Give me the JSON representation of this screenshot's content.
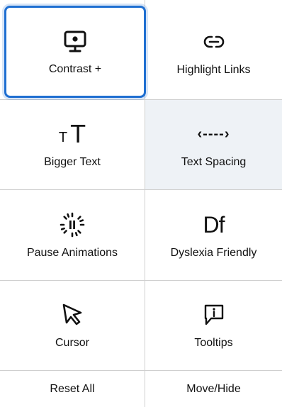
{
  "tiles": {
    "contrast": {
      "label": "Contrast +",
      "icon": "monitor-icon"
    },
    "highlight_links": {
      "label": "Highlight Links",
      "icon": "link-icon"
    },
    "bigger_text": {
      "label": "Bigger Text",
      "icon": "text-size-icon",
      "glyph_small": "T",
      "glyph_large": "T"
    },
    "text_spacing": {
      "label": "Text Spacing",
      "icon": "spacing-arrows-icon",
      "glyph": "‹----›"
    },
    "pause_animations": {
      "label": "Pause Animations",
      "icon": "pause-icon"
    },
    "dyslexia_friendly": {
      "label": "Dyslexia Friendly",
      "icon": "dyslexia-icon",
      "glyph": "Df"
    },
    "cursor": {
      "label": "Cursor",
      "icon": "cursor-icon"
    },
    "tooltips": {
      "label": "Tooltips",
      "icon": "tooltip-icon"
    }
  },
  "footer": {
    "reset": "Reset All",
    "move_hide": "Move/Hide"
  },
  "colors": {
    "focus_ring": "#1f6fd1",
    "hover_bg": "#eef2f6",
    "divider": "#cfcfcf"
  }
}
